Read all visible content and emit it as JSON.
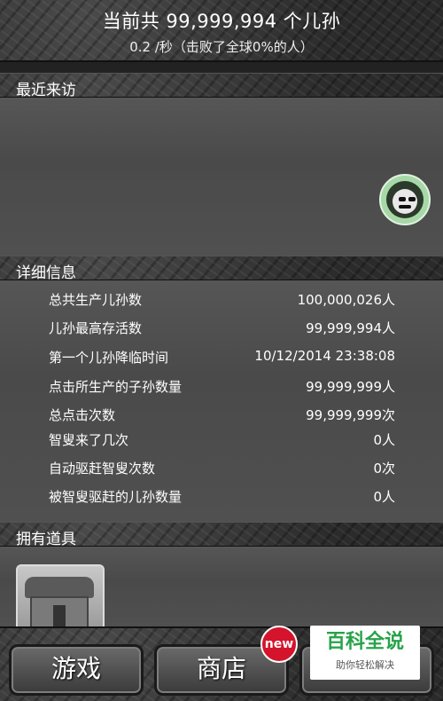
{
  "header": {
    "total_text": "当前共 99,999,994 个儿孙",
    "rate_text": "0.2 /秒（击败了全球0%的人）"
  },
  "sections": {
    "recent_visitors": "最近来访",
    "details": "详细信息",
    "items": "拥有道具"
  },
  "visitor": {
    "icon": "grim-reaper-icon",
    "color": "#a7d8a7"
  },
  "stats": [
    {
      "label": "总共生产儿孙数",
      "value": "100,000,026人"
    },
    {
      "label": "儿孙最高存活数",
      "value": "99,999,994人"
    },
    {
      "label": "第一个儿孙降临时间",
      "value": "10/12/2014 23:38:08"
    },
    {
      "label": "点击所生产的子孙数量",
      "value": "99,999,999人"
    },
    {
      "label": "总点击次数",
      "value": "99,999,999次"
    },
    {
      "label": "智叟来了几次",
      "value": "0人"
    },
    {
      "label": "自动驱赶智叟次数",
      "value": "0次"
    },
    {
      "label": "被智叟驱赶的儿孙数量",
      "value": "0人"
    }
  ],
  "owned_items": [
    {
      "icon": "hut-icon"
    }
  ],
  "tabs": {
    "game": "游戏",
    "shop": "商店",
    "new_badge": "new"
  },
  "watermark": {
    "title": "百科全说",
    "subtitle": "助你轻松解决"
  },
  "colors": {
    "badge": "#d4142c",
    "watermark_green": "#27a34a"
  }
}
